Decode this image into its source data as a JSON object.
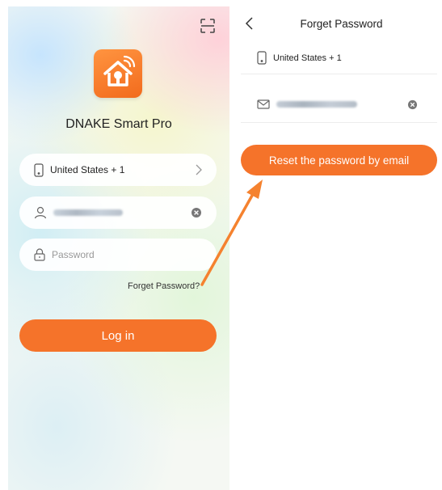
{
  "login": {
    "app_name": "DNAKE Smart Pro",
    "region": {
      "label": "United States + 1"
    },
    "username": {
      "value": ""
    },
    "password": {
      "placeholder": "Password"
    },
    "forget_link": "Forget Password?",
    "login_button": "Log in",
    "icons": [
      "scan-icon",
      "app-logo",
      "phone-icon",
      "chevron-right-icon",
      "user-icon",
      "clear-icon",
      "lock-icon"
    ]
  },
  "forget": {
    "title": "Forget Password",
    "region": {
      "label": "United States + 1"
    },
    "email": {
      "value": ""
    },
    "reset_button": "Reset the password by email",
    "icons": [
      "back-chevron-icon",
      "phone-icon",
      "mail-icon",
      "clear-icon"
    ]
  },
  "colors": {
    "accent": "#f5732a",
    "arrow": "#f5822f",
    "text": "#222222",
    "placeholder": "#999999",
    "divider": "#ececec"
  }
}
